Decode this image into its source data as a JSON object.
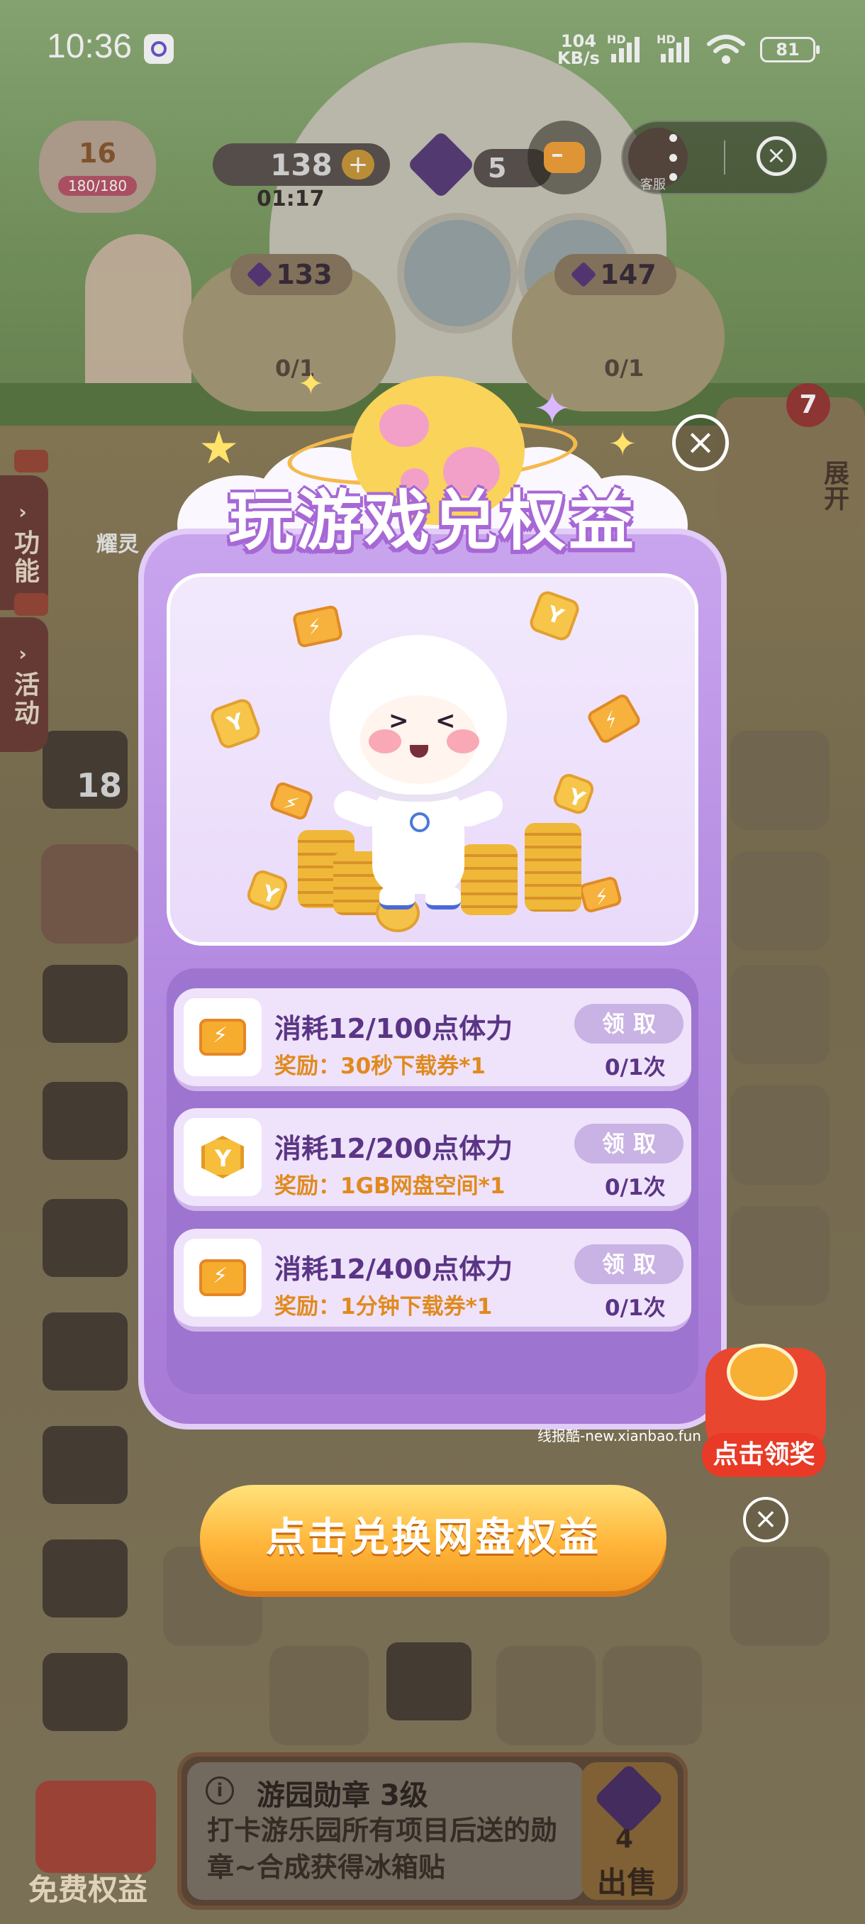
{
  "status_bar": {
    "time": "10:36",
    "net_speed_value": "104",
    "net_speed_unit": "KB/s",
    "sim1_label": "HD",
    "sim2_label": "HD",
    "battery": "81"
  },
  "hud": {
    "level": "16",
    "level_progress": "180/180",
    "stamina": "138",
    "stamina_timer": "01:17",
    "gems": "5",
    "capsule_hint": "客服"
  },
  "bubbles": [
    {
      "gems": "133",
      "progress": "0/1"
    },
    {
      "gems": "147",
      "progress": "0/1"
    }
  ],
  "side_tabs": {
    "function": "功能",
    "activity": "活动"
  },
  "scene": {
    "left_label": "耀灵",
    "cell_number": "18",
    "right_badge": "7",
    "right_expand": "展开"
  },
  "modal": {
    "title": "玩游戏兑权益",
    "rows": [
      {
        "title": "消耗12/100点体力",
        "reward": "奖励：30秒下载券*1",
        "button": "领取",
        "count": "0/1次",
        "icon": "ticket-icon"
      },
      {
        "title": "消耗12/200点体力",
        "reward": "奖励：1GB网盘空间*1",
        "button": "领取",
        "count": "0/1次",
        "icon": "hex-coin-icon"
      },
      {
        "title": "消耗12/400点体力",
        "reward": "奖励：1分钟下载券*1",
        "button": "领取",
        "count": "0/1次",
        "icon": "ticket-icon"
      }
    ],
    "cta": "点击兑换网盘权益"
  },
  "floating": {
    "reward_label": "点击领奖"
  },
  "watermark": "线报酷-new.xianbao.fun",
  "bottom": {
    "free_label": "免费权益",
    "medal_title": "游园勋章 3级",
    "medal_desc": "打卡游乐园所有项目后送的勋章~合成获得冰箱贴",
    "sell_count": "4",
    "sell_label": "出售"
  },
  "colors": {
    "modal_purple": "#b38ae0",
    "accent_orange": "#f39a24",
    "reward_orange": "#e08a1e",
    "title_purple": "#5a3585"
  }
}
